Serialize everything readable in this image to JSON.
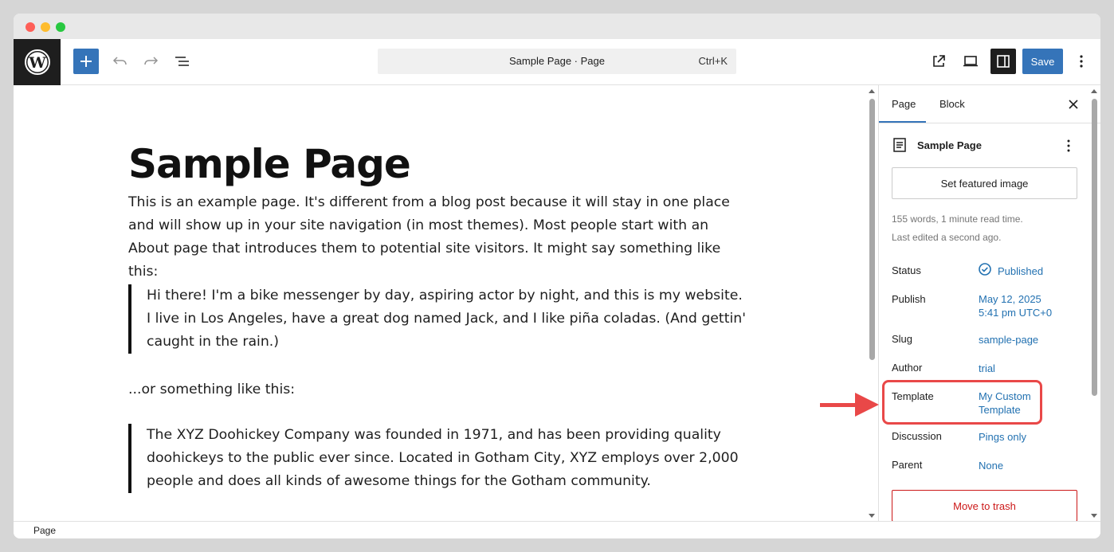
{
  "toolbar": {
    "command_title": "Sample Page · Page",
    "shortcut": "Ctrl+K",
    "save_label": "Save"
  },
  "editor": {
    "title": "Sample Page",
    "paragraph1": "This is an example page. It's different from a blog post because it will stay in one place and will show up in your site navigation (in most themes). Most people start with an About page that introduces them to potential site visitors. It might say something like this:",
    "quote1": "Hi there! I'm a bike messenger by day, aspiring actor by night, and this is my website. I live in Los Angeles, have a great dog named Jack, and I like piña coladas. (And gettin' caught in the rain.)",
    "paragraph2": "...or something like this:",
    "quote2": "The XYZ Doohickey Company was founded in 1971, and has been providing quality doohickeys to the public ever since. Located in Gotham City, XYZ employs over 2,000 people and does all kinds of awesome things for the Gotham community."
  },
  "sidebar": {
    "tabs": [
      "Page",
      "Block"
    ],
    "page_name": "Sample Page",
    "featured_image_label": "Set featured image",
    "word_count": "155 words, 1 minute read time.",
    "last_edited": "Last edited a second ago.",
    "rows": {
      "status": {
        "label": "Status",
        "value": "Published"
      },
      "publish": {
        "label": "Publish",
        "value_line1": "May 12, 2025",
        "value_line2": "5:41 pm UTC+0"
      },
      "slug": {
        "label": "Slug",
        "value": "sample-page"
      },
      "author": {
        "label": "Author",
        "value": "trial"
      },
      "template": {
        "label": "Template",
        "value_line1": "My Custom",
        "value_line2": "Template"
      },
      "discussion": {
        "label": "Discussion",
        "value": "Pings only"
      },
      "parent": {
        "label": "Parent",
        "value": "None"
      }
    },
    "trash_label": "Move to trash"
  },
  "statusbar": {
    "label": "Page"
  },
  "colors": {
    "accent": "#3574b9",
    "link": "#2271b1",
    "highlight": "#e94848",
    "danger": "#cc1818",
    "dark": "#1e1e1e"
  },
  "icons": [
    "wordpress-logo-icon",
    "plus-icon",
    "undo-icon",
    "redo-icon",
    "list-view-icon",
    "external-link-icon",
    "device-preview-icon",
    "sidebar-toggle-icon",
    "kebab-menu-icon",
    "close-icon",
    "document-icon",
    "check-circle-icon",
    "arrow-right-icon"
  ]
}
